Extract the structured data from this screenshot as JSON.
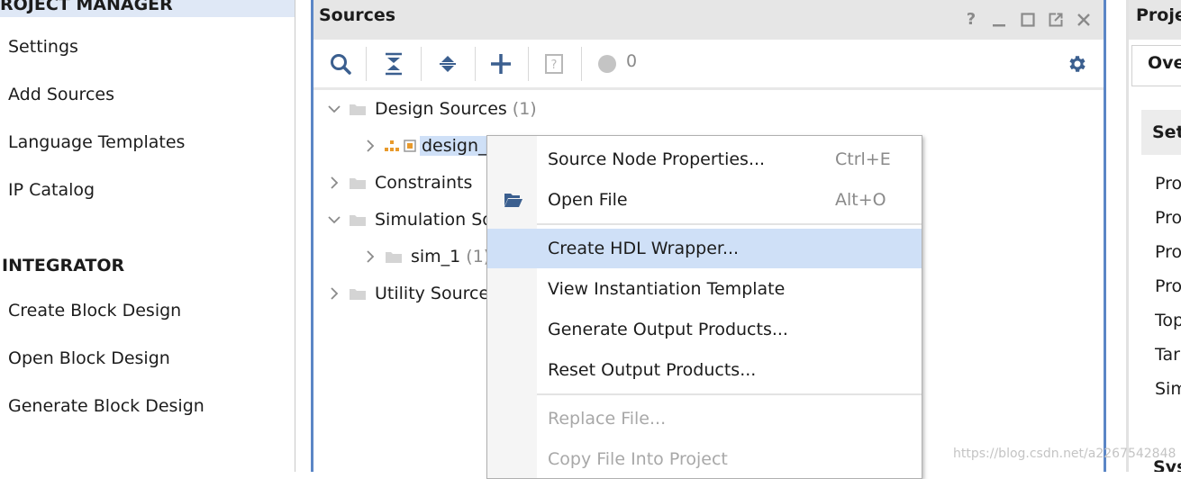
{
  "left_nav": {
    "project_manager_header": "ROJECT MANAGER",
    "project_items": [
      "Settings",
      "Add Sources",
      "Language Templates",
      "IP Catalog"
    ],
    "ip_integrator_header": "INTEGRATOR",
    "ipi_items": [
      "Create Block Design",
      "Open Block Design",
      "Generate Block Design"
    ]
  },
  "sources": {
    "title": "Sources",
    "window_icons": [
      "help-icon",
      "minimize-icon",
      "maximize-icon",
      "float-icon",
      "close-icon"
    ],
    "toolbar": {
      "icons": [
        "search-icon",
        "collapse-all-icon",
        "expand-all-icon",
        "add-icon",
        "properties-icon",
        "status-dot-icon",
        "settings-gear-icon"
      ],
      "status_count": "0"
    },
    "tree": {
      "design_sources": "Design Sources",
      "design_sources_count": "(1)",
      "design_item": "design_",
      "constraints": "Constraints",
      "simulation_sources": "Simulation So",
      "sim_1": "sim_1",
      "sim_1_count": "(1)",
      "utility_sources": "Utility Source"
    }
  },
  "context_menu": {
    "items": [
      {
        "label": "Source Node Properties...",
        "shortcut": "Ctrl+E",
        "state": "normal"
      },
      {
        "label": "Open File",
        "shortcut": "Alt+O",
        "state": "normal",
        "icon": "open-folder-icon"
      },
      {
        "label": "Create HDL Wrapper...",
        "shortcut": "",
        "state": "highlighted"
      },
      {
        "label": "View Instantiation Template",
        "shortcut": "",
        "state": "normal"
      },
      {
        "label": "Generate Output Products...",
        "shortcut": "",
        "state": "normal"
      },
      {
        "label": "Reset Output Products...",
        "shortcut": "",
        "state": "normal"
      },
      {
        "label": "Replace File...",
        "shortcut": "",
        "state": "disabled"
      },
      {
        "label": "Copy File Into Project",
        "shortcut": "",
        "state": "disabled"
      }
    ]
  },
  "right_panel": {
    "title": "Proje",
    "tab": "Ove",
    "section": "Set",
    "rows": [
      "Pro",
      "Pro",
      "Pro",
      "Pro",
      "Top",
      "Tar",
      "Sim"
    ],
    "bottom": "Sys"
  },
  "watermark": "https://blog.csdn.net/a2267542848"
}
